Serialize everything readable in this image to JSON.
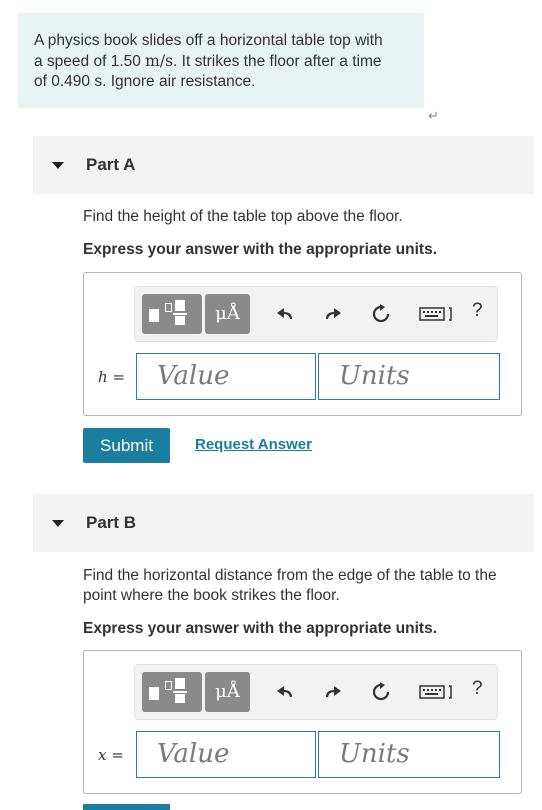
{
  "intro": {
    "line1": "A physics book slides off a horizontal table top with",
    "line2_pre": "a speed of 1.50 ",
    "line2_unit": "m/s",
    "line2_post": ". It strikes the floor after a time",
    "line3": "of 0.490 s. Ignore air resistance."
  },
  "return_icon": "↵",
  "partA": {
    "title": "Part A",
    "question": "Find the height of the table top above the floor.",
    "instruction": "Express your answer with the appropriate units.",
    "variable": "h",
    "equals": " =",
    "value_placeholder": "Value",
    "units_placeholder": "Units",
    "submit_label": "Submit",
    "request_label": "Request Answer"
  },
  "partB": {
    "title": "Part B",
    "question_line1": "Find the horizontal distance from the edge of the table to the",
    "question_line2": "point where the book strikes the floor.",
    "instruction": "Express your answer with the appropriate units.",
    "variable": "x",
    "equals": " =",
    "value_placeholder": "Value",
    "units_placeholder": "Units"
  },
  "toolbar": {
    "symbol_label": "μÅ",
    "help_label": "?",
    "icons": [
      "templates-icon",
      "symbols-icon",
      "undo-icon",
      "redo-icon",
      "reset-icon",
      "keyboard-icon",
      "help-icon"
    ]
  },
  "colors": {
    "accent": "#1a7ea0",
    "intro_bg": "#e8f4f4",
    "part_header_bg": "#f3f3f3",
    "toolbar_btn": "#8a8a8a"
  }
}
